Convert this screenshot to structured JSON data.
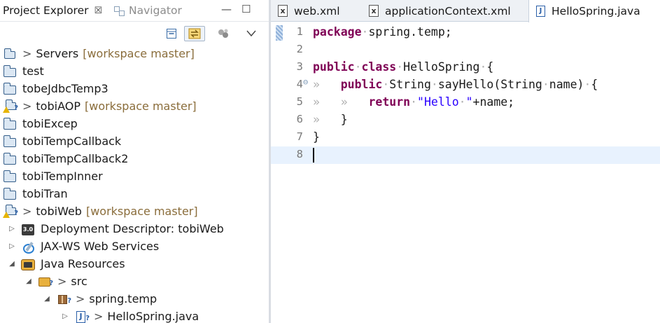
{
  "explorer": {
    "tabs": [
      {
        "label": "Project Explorer",
        "close": "☒"
      },
      {
        "label": "Navigator"
      }
    ],
    "view_controls": {
      "minimize": "—",
      "maximize": "☐"
    },
    "toolbar_icons": [
      "collapse-all-icon",
      "link-with-editor-icon",
      "filter-icon",
      "view-menu-icon"
    ],
    "tree": [
      {
        "label": "Servers",
        "decoration": "[workspace master]",
        "prefix": ">",
        "icon": "server-folder-icon"
      },
      {
        "label": "test",
        "icon": "folder-icon"
      },
      {
        "label": "tobeJdbcTemp3",
        "icon": "folder-icon"
      },
      {
        "label": "tobiAOP",
        "decoration": "[workspace master]",
        "prefix": ">",
        "icon": "project-warning-icon"
      },
      {
        "label": "tobiExcep",
        "icon": "folder-icon"
      },
      {
        "label": "tobiTempCallback",
        "icon": "folder-icon"
      },
      {
        "label": "tobiTempCallback2",
        "icon": "folder-icon"
      },
      {
        "label": "tobiTempInner",
        "icon": "folder-icon"
      },
      {
        "label": "tobiTran",
        "icon": "folder-icon"
      },
      {
        "label": "tobiWeb",
        "decoration": "[workspace master]",
        "prefix": ">",
        "icon": "project-warning-icon"
      },
      {
        "label": "Deployment Descriptor: tobiWeb",
        "arrow": "▷",
        "badge": "3.0",
        "icon": "deployment-descriptor-icon"
      },
      {
        "label": "JAX-WS Web Services",
        "arrow": "▷",
        "icon": "web-services-icon"
      },
      {
        "label": "Java Resources",
        "arrow": "◢",
        "icon": "java-resources-icon"
      },
      {
        "label": "src",
        "prefix": ">",
        "arrow": "◢",
        "icon": "source-folder-icon"
      },
      {
        "label": "spring.temp",
        "prefix": ">",
        "arrow": "◢",
        "icon": "package-icon"
      },
      {
        "label": "HelloSpring.java",
        "prefix": ">",
        "arrow": "▷",
        "file_letter": "J",
        "icon": "java-file-icon"
      }
    ]
  },
  "editor": {
    "tabs": [
      {
        "label": "web.xml",
        "file_letter": "x",
        "active": false
      },
      {
        "label": "applicationContext.xml",
        "file_letter": "x",
        "active": false
      },
      {
        "label": "HelloSpring.java",
        "file_letter": "J",
        "active": true
      }
    ],
    "lines": [
      {
        "n": "1",
        "tokens": [
          {
            "t": "package",
            "c": "kw"
          },
          {
            "t": "·spring.temp;",
            "c": ""
          }
        ]
      },
      {
        "n": "2",
        "tokens": []
      },
      {
        "n": "3",
        "tokens": [
          {
            "t": "public",
            "c": "kw"
          },
          {
            "t": "·",
            "c": "ws"
          },
          {
            "t": "class",
            "c": "kw"
          },
          {
            "t": "·HelloSpring·{",
            "c": ""
          }
        ]
      },
      {
        "n": "4",
        "fold": "⊖",
        "tokens": [
          {
            "t": "»   ",
            "c": "ws"
          },
          {
            "t": "public",
            "c": "kw"
          },
          {
            "t": "·String·sayHello(String·name)·{",
            "c": ""
          }
        ]
      },
      {
        "n": "5",
        "tokens": [
          {
            "t": "»   »   ",
            "c": "ws"
          },
          {
            "t": "return",
            "c": "kw"
          },
          {
            "t": "·",
            "c": "ws"
          },
          {
            "t": "\"Hello·\"",
            "c": "str"
          },
          {
            "t": "+name;",
            "c": ""
          }
        ]
      },
      {
        "n": "6",
        "tokens": [
          {
            "t": "»   ",
            "c": "ws"
          },
          {
            "t": "}",
            "c": ""
          }
        ]
      },
      {
        "n": "7",
        "tokens": [
          {
            "t": "}",
            "c": ""
          }
        ]
      },
      {
        "n": "8",
        "tokens": [],
        "current": true
      }
    ]
  },
  "colors": {
    "keyword": "#7f0055",
    "string": "#2a00ff",
    "decoration": "#8a6d3b",
    "current_line": "#e8f2fe"
  }
}
